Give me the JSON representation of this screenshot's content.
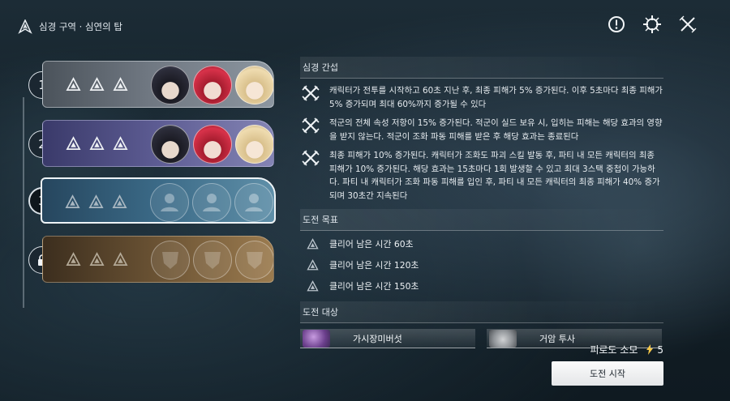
{
  "header": {
    "breadcrumb": "심경 구역 · 심연의 탑"
  },
  "top_icons": [
    "alert-circle-icon",
    "crosshair-icon",
    "close-icon"
  ],
  "floors": [
    {
      "number": "1",
      "state": "cleared",
      "stars": 3,
      "party": [
        "black-haired-character",
        "red-haired-character",
        "blonde-character"
      ]
    },
    {
      "number": "2",
      "state": "cleared",
      "stars": 3,
      "party": [
        "black-haired-character",
        "red-haired-character",
        "blonde-character"
      ]
    },
    {
      "number": "3",
      "state": "selected",
      "stars": 3,
      "party": [
        "empty",
        "empty",
        "empty"
      ]
    },
    {
      "number": "",
      "state": "locked",
      "stars": 3,
      "party": [
        "empty",
        "empty",
        "empty"
      ]
    }
  ],
  "interference": {
    "title": "심경 간섭",
    "effects": [
      {
        "icon": "crossed-swords-icon",
        "text": "캐릭터가 전투를 시작하고 60초 지난 후, 최종 피해가 5% 증가된다. 이후 5초마다 최종 피해가 5% 증가되며 최대 60%까지 증가될 수 있다"
      },
      {
        "icon": "crossed-swords-icon",
        "text": "적군의 전체 속성 저항이 15% 증가된다. 적군이 실드 보유 시, 입히는 피해는 해당 효과의 영향을 받지 않는다. 적군이 조화 파동 피해를 받은 후 해당 효과는 종료된다"
      },
      {
        "icon": "crossed-swords-icon",
        "text": "최종 피해가 10% 증가된다. 캐릭터가 조화도 파괴 스킬 발동 후, 파티 내 모든 캐릭터의 최종 피해가 10% 증가된다. 해당 효과는 15초마다 1회 발생할 수 있고 최대 3스택 중첩이 가능하다. 파티 내 캐릭터가 조화 파동 피해를 입인 후, 파티 내 모든 캐릭터의 최종 피해가 40% 증가되며 30초간 지속된다"
      }
    ]
  },
  "goals": {
    "title": "도전 목표",
    "items": [
      "클리어 남은 시간 60초",
      "클리어 남은 시간 120초",
      "클리어 남은 시간 150초"
    ]
  },
  "targets": {
    "title": "도전 대상",
    "items": [
      {
        "name": "가시장미버섯",
        "icon": "mushroom-enemy-portrait"
      },
      {
        "name": "거암 투사",
        "icon": "rock-enemy-portrait"
      }
    ]
  },
  "stamina": {
    "label": "피로도 소모",
    "value": "5"
  },
  "start_button": "도전 시작",
  "colors": {
    "floor1": "#6f7781",
    "floor2": "#5d5c93",
    "floor3": "#3b6a87",
    "floor4": "#6b5334"
  }
}
